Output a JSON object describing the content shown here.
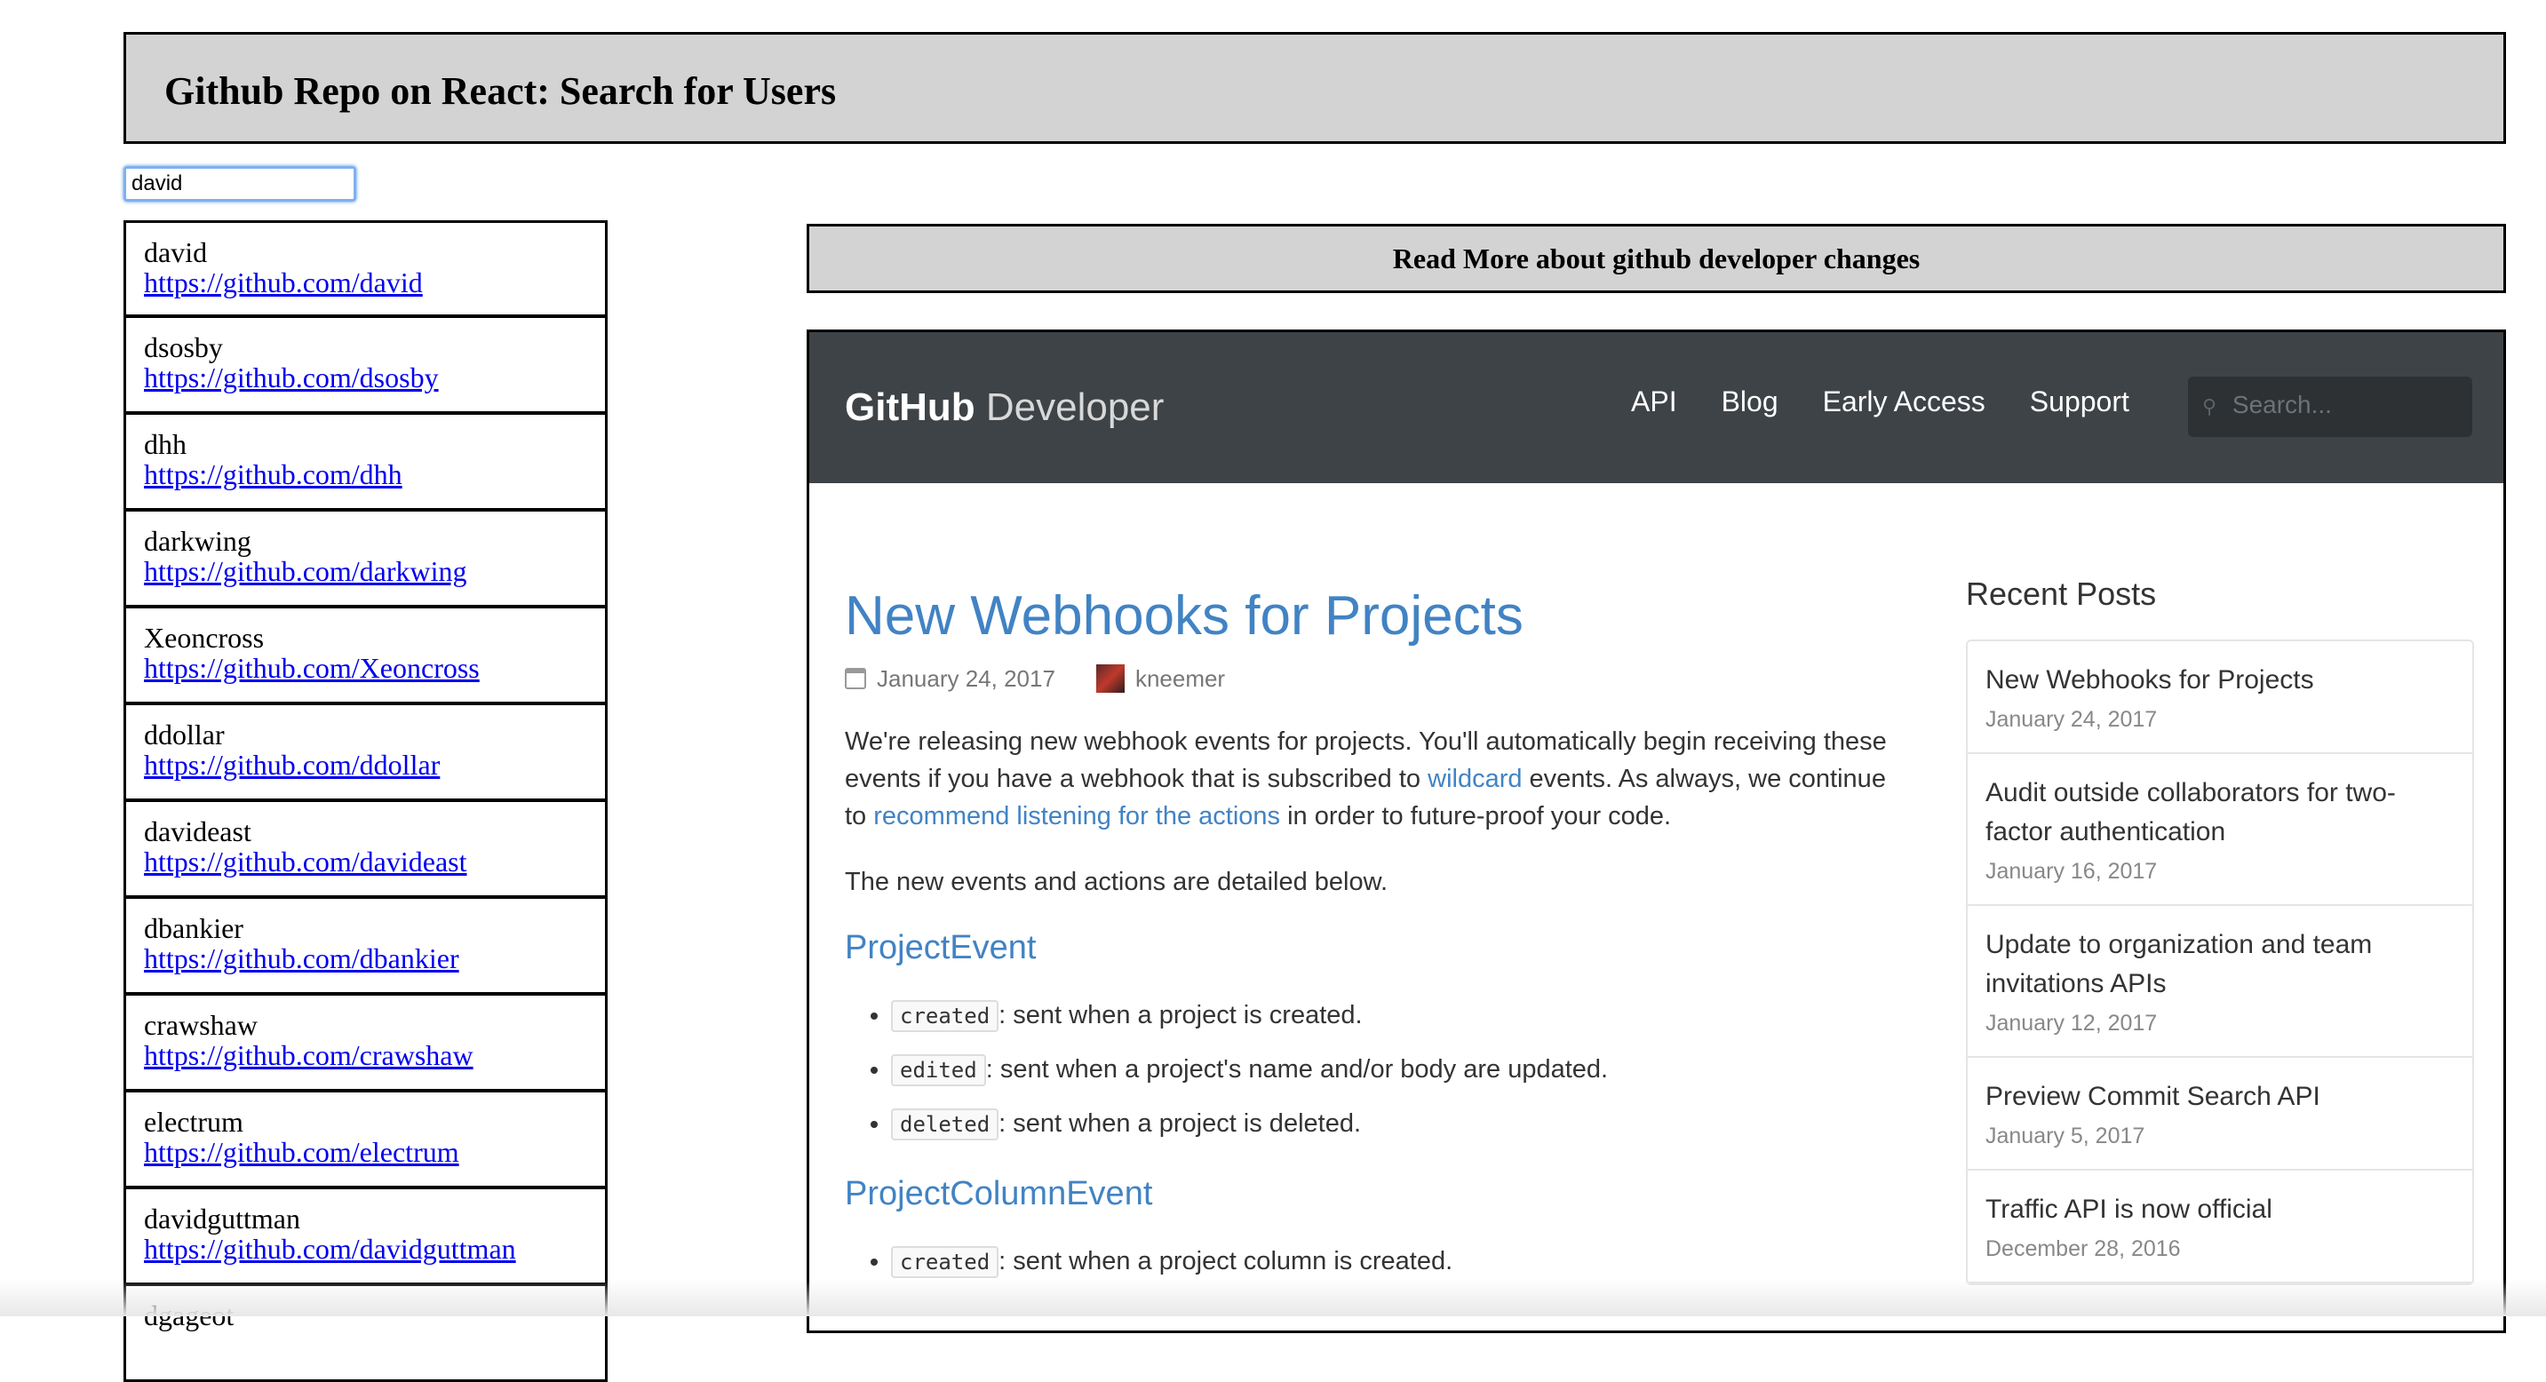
{
  "header": {
    "title": "Github Repo on React: Search for Users"
  },
  "search": {
    "value": "david"
  },
  "users": [
    {
      "login": "david",
      "url": "https://github.com/david"
    },
    {
      "login": "dsosby",
      "url": "https://github.com/dsosby"
    },
    {
      "login": "dhh",
      "url": "https://github.com/dhh"
    },
    {
      "login": "darkwing",
      "url": "https://github.com/darkwing"
    },
    {
      "login": "Xeoncross",
      "url": "https://github.com/Xeoncross"
    },
    {
      "login": "ddollar",
      "url": "https://github.com/ddollar"
    },
    {
      "login": "davideast",
      "url": "https://github.com/davideast"
    },
    {
      "login": "dbankier",
      "url": "https://github.com/dbankier"
    },
    {
      "login": "crawshaw",
      "url": "https://github.com/crawshaw"
    },
    {
      "login": "electrum",
      "url": "https://github.com/electrum"
    },
    {
      "login": "davidguttman",
      "url": "https://github.com/davidguttman"
    },
    {
      "login": "dgageot",
      "url": ""
    }
  ],
  "readmore": {
    "label": "Read More about github developer changes"
  },
  "gh": {
    "logo_bold": "GitHub",
    "logo_light": "Developer",
    "nav": [
      "API",
      "Blog",
      "Early Access",
      "Support"
    ],
    "search_placeholder": "Search...",
    "post": {
      "title": "New Webhooks for Projects",
      "date": "January 24, 2017",
      "author": "kneemer",
      "p1_a": "We're releasing new webhook events for projects. You'll automatically begin receiving these events if you have a webhook that is subscribed to ",
      "p1_link1": "wildcard",
      "p1_b": " events. As always, we continue to ",
      "p1_link2": "recommend listening for the actions",
      "p1_c": " in order to future-proof your code.",
      "p2": "The new events and actions are detailed below.",
      "h_project_event": "ProjectEvent",
      "project_event_items": [
        {
          "code": "created",
          "text": ": sent when a project is created."
        },
        {
          "code": "edited",
          "text": ": sent when a project's name and/or body are updated."
        },
        {
          "code": "deleted",
          "text": ": sent when a project is deleted."
        }
      ],
      "h_project_column_event": "ProjectColumnEvent",
      "project_column_items": [
        {
          "code": "created",
          "text": ": sent when a project column is created."
        }
      ]
    },
    "sidebar": {
      "heading": "Recent Posts",
      "posts": [
        {
          "title": "New Webhooks for Projects",
          "date": "January 24, 2017"
        },
        {
          "title": "Audit outside collaborators for two-factor authentication",
          "date": "January 16, 2017"
        },
        {
          "title": "Update to organization and team invitations APIs",
          "date": "January 12, 2017"
        },
        {
          "title": "Preview Commit Search API",
          "date": "January 5, 2017"
        },
        {
          "title": "Traffic API is now official",
          "date": "December 28, 2016"
        }
      ]
    }
  }
}
